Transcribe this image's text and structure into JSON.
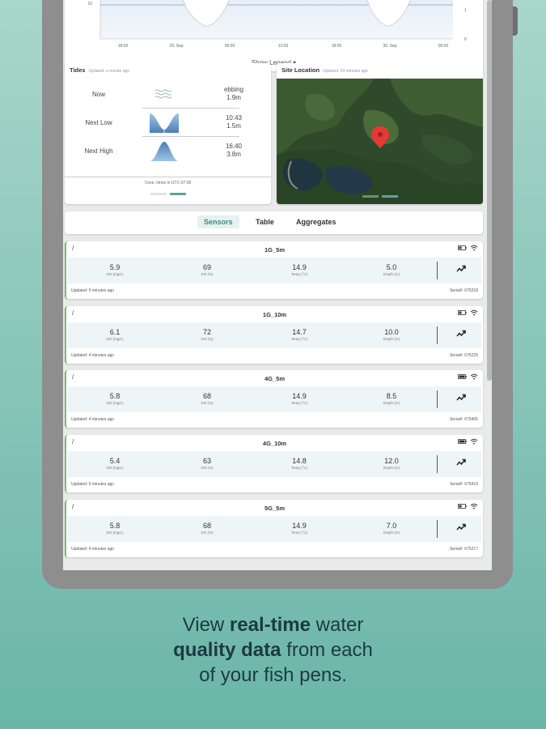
{
  "chart": {
    "x_ticks": [
      "18:00",
      "29. Sep",
      "06:00",
      "12:00",
      "18:00",
      "30. Sep",
      "06:00"
    ],
    "y_left_tick": "10",
    "y_right_ticks": [
      "1",
      "0"
    ],
    "show_legend": "Show Legend ▾"
  },
  "tides": {
    "title": "Tides",
    "updated": "Updated: a minute ago",
    "rows": [
      {
        "label": "Now",
        "value1": "ebbing",
        "value2": "1.9m",
        "icon": "waves-icon"
      },
      {
        "label": "Next Low",
        "value1": "10:43",
        "value2": "1.5m",
        "icon": "tide-low-icon"
      },
      {
        "label": "Next High",
        "value1": "16:40",
        "value2": "3.8m",
        "icon": "tide-high-icon"
      }
    ],
    "footer": "Cove, times in UTC-07:00"
  },
  "site": {
    "title": "Site Location",
    "updated": "Updated: 24 minutes ago"
  },
  "tabs": [
    {
      "label": "Sensors",
      "active": true
    },
    {
      "label": "Table",
      "active": false
    },
    {
      "label": "Aggregates",
      "active": false
    }
  ],
  "sensors": [
    {
      "name": "1G_5m",
      "do_mgl": "5.9",
      "do_pct": "69",
      "temp": "14.9",
      "depth": "5.0",
      "updated": "Updated: 5 minutes ago",
      "serial": "Serial#: 675218"
    },
    {
      "name": "1G_10m",
      "do_mgl": "6.1",
      "do_pct": "72",
      "temp": "14.7",
      "depth": "10.0",
      "updated": "Updated: 4 minutes ago",
      "serial": "Serial#: 675225"
    },
    {
      "name": "4G_5m",
      "do_mgl": "5.8",
      "do_pct": "68",
      "temp": "14.9",
      "depth": "8.5",
      "updated": "Updated: 4 minutes ago",
      "serial": "Serial#: 675405"
    },
    {
      "name": "4G_10m",
      "do_mgl": "5.4",
      "do_pct": "63",
      "temp": "14.8",
      "depth": "12.0",
      "updated": "Updated: 5 minutes ago",
      "serial": "Serial#: 675410"
    },
    {
      "name": "5G_5m",
      "do_mgl": "5.8",
      "do_pct": "68",
      "temp": "14.9",
      "depth": "7.0",
      "updated": "Updated: 4 minutes ago",
      "serial": "Serial#: 675217"
    }
  ],
  "units": {
    "do_mgl": "DO (mg/L)",
    "do_pct": "DO (%)",
    "temp": "Temp (°C)",
    "depth": "Depth (m)"
  },
  "caption": {
    "line1_plain": "View ",
    "line1_bold": "real-time",
    "line1_end": " water",
    "line2_bold": "quality data",
    "line2_end": " from each",
    "line3": "of your fish pens."
  },
  "colors": {
    "accent": "#3c8c86",
    "sensor_border": "#7bbf6a",
    "caption_text": "#1b3a44"
  }
}
